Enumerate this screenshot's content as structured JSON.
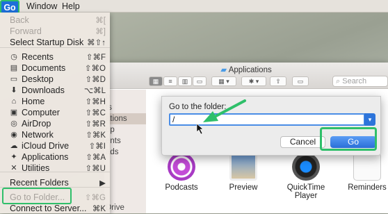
{
  "menubar": {
    "go": "Go",
    "window": "Window",
    "help": "Help"
  },
  "go_menu": {
    "items": [
      {
        "label": "Back",
        "shortcut": "⌘[",
        "disabled": true,
        "icon": ""
      },
      {
        "label": "Forward",
        "shortcut": "⌘]",
        "disabled": true,
        "icon": ""
      },
      {
        "label": "Select Startup Disk",
        "shortcut": "⌘⇧↑",
        "disabled": false,
        "icon": ""
      },
      {
        "label": "Recents",
        "shortcut": "⇧⌘F",
        "disabled": false,
        "icon": "clock-icon"
      },
      {
        "label": "Documents",
        "shortcut": "⇧⌘O",
        "disabled": false,
        "icon": "document-icon"
      },
      {
        "label": "Desktop",
        "shortcut": "⇧⌘D",
        "disabled": false,
        "icon": "desktop-icon"
      },
      {
        "label": "Downloads",
        "shortcut": "⌥⌘L",
        "disabled": false,
        "icon": "download-icon"
      },
      {
        "label": "Home",
        "shortcut": "⇧⌘H",
        "disabled": false,
        "icon": "home-icon"
      },
      {
        "label": "Computer",
        "shortcut": "⇧⌘C",
        "disabled": false,
        "icon": "computer-icon"
      },
      {
        "label": "AirDrop",
        "shortcut": "⇧⌘R",
        "disabled": false,
        "icon": "airdrop-icon"
      },
      {
        "label": "Network",
        "shortcut": "⇧⌘K",
        "disabled": false,
        "icon": "network-icon"
      },
      {
        "label": "iCloud Drive",
        "shortcut": "⇧⌘I",
        "disabled": false,
        "icon": "cloud-icon"
      },
      {
        "label": "Applications",
        "shortcut": "⇧⌘A",
        "disabled": false,
        "icon": "applications-icon"
      },
      {
        "label": "Utilities",
        "shortcut": "⇧⌘U",
        "disabled": false,
        "icon": "utilities-icon"
      },
      {
        "label": "Recent Folders",
        "shortcut": "▶",
        "disabled": false,
        "icon": ""
      },
      {
        "label": "Go to Folder...",
        "shortcut": "⇧⌘G",
        "disabled": true,
        "icon": ""
      },
      {
        "label": "Connect to Server...",
        "shortcut": "⌘K",
        "disabled": false,
        "icon": ""
      }
    ]
  },
  "finder": {
    "title": "Applications",
    "search_placeholder": "Search",
    "sidebar": [
      "p",
      "ts",
      "ations",
      "op",
      "ents",
      "ads",
      "Drive"
    ],
    "apps": [
      {
        "name": "Podcasts"
      },
      {
        "name": "Preview"
      },
      {
        "name": "QuickTime Player"
      },
      {
        "name": "Reminders"
      }
    ]
  },
  "dialog": {
    "label": "Go to the folder:",
    "input_value": "/",
    "cancel": "Cancel",
    "go": "Go"
  },
  "colors": {
    "accent": "#2a6fd8",
    "highlight_box": "#2fbf6a"
  }
}
